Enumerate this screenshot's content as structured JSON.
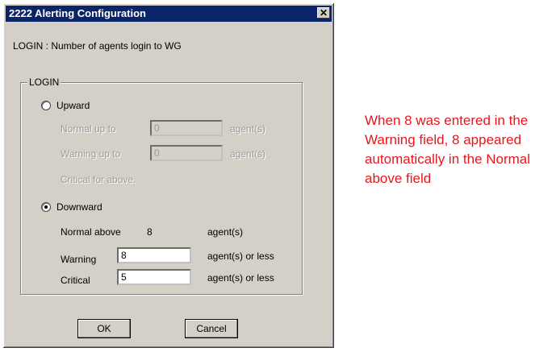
{
  "window": {
    "title": "2222 Alerting Configuration",
    "close_glyph": "✕"
  },
  "description": "LOGIN  : Number of agents login to WG",
  "group": {
    "legend": "LOGIN"
  },
  "upward": {
    "label": "Upward",
    "selected": false,
    "normal_label": "Normal up to",
    "normal_value": "0",
    "warning_label": "Warning up to",
    "warning_value": "0",
    "unit": "agent(s)",
    "critical_text": "Critical for above."
  },
  "downward": {
    "label": "Downward",
    "selected": true,
    "normal_label": "Normal above",
    "normal_value": "8",
    "normal_unit": "agent(s)",
    "warning_label": "Warning",
    "warning_value": "8",
    "warning_unit": "agent(s) or less",
    "critical_label": "Critical",
    "critical_value": "5",
    "critical_unit": "agent(s) or less"
  },
  "buttons": {
    "ok": "OK",
    "cancel": "Cancel"
  },
  "annotation": "When 8 was entered in the Warning field, 8 appeared automatically in the Normal above field",
  "colors": {
    "title_bar": "#0a246a",
    "dialog_bg": "#d4d0c8",
    "annotation": "#e8161c"
  }
}
